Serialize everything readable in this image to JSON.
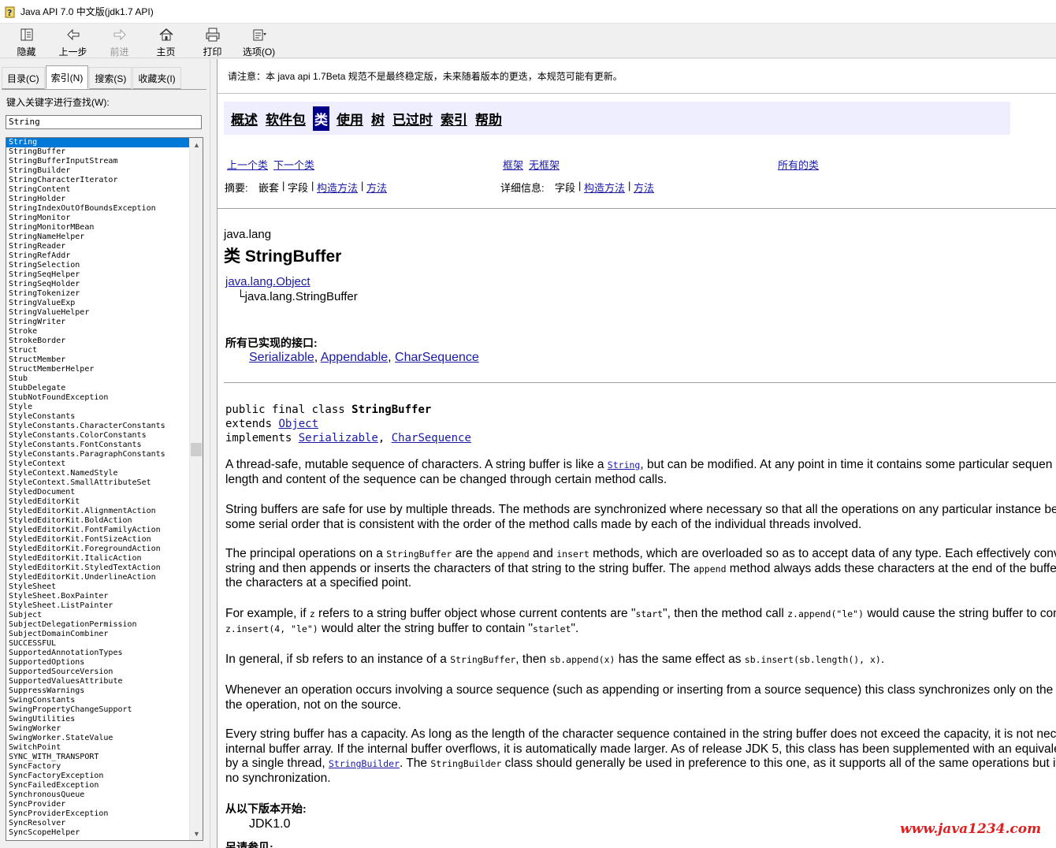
{
  "window": {
    "title": "Java API 7.0 中文版(jdk1.7 API)"
  },
  "toolbar": {
    "buttons": [
      {
        "label": "隐藏",
        "icon": "hide-icon",
        "enabled": true
      },
      {
        "label": "上一步",
        "icon": "back-arrow-icon",
        "enabled": true
      },
      {
        "label": "前进",
        "icon": "forward-arrow-icon",
        "enabled": false
      },
      {
        "label": "主页",
        "icon": "home-icon",
        "enabled": true
      },
      {
        "label": "打印",
        "icon": "printer-icon",
        "enabled": true
      },
      {
        "label": "选项(O)",
        "icon": "options-icon",
        "enabled": true
      }
    ]
  },
  "sidebar": {
    "tabs": [
      "目录(C)",
      "索引(N)",
      "搜索(S)",
      "收藏夹(I)"
    ],
    "active_tab": "索引(N)",
    "keyword_label": "键入关键字进行查找(W):",
    "keyword_value": "String",
    "selected_item": "String",
    "items": [
      "String",
      "StringBuffer",
      "StringBufferInputStream",
      "StringBuilder",
      "StringCharacterIterator",
      "StringContent",
      "StringHolder",
      "StringIndexOutOfBoundsException",
      "StringMonitor",
      "StringMonitorMBean",
      "StringNameHelper",
      "StringReader",
      "StringRefAddr",
      "StringSelection",
      "StringSeqHelper",
      "StringSeqHolder",
      "StringTokenizer",
      "StringValueExp",
      "StringValueHelper",
      "StringWriter",
      "Stroke",
      "StrokeBorder",
      "Struct",
      "StructMember",
      "StructMemberHelper",
      "Stub",
      "StubDelegate",
      "StubNotFoundException",
      "Style",
      "StyleConstants",
      "StyleConstants.CharacterConstants",
      "StyleConstants.ColorConstants",
      "StyleConstants.FontConstants",
      "StyleConstants.ParagraphConstants",
      "StyleContext",
      "StyleContext.NamedStyle",
      "StyleContext.SmallAttributeSet",
      "StyledDocument",
      "StyledEditorKit",
      "StyledEditorKit.AlignmentAction",
      "StyledEditorKit.BoldAction",
      "StyledEditorKit.FontFamilyAction",
      "StyledEditorKit.FontSizeAction",
      "StyledEditorKit.ForegroundAction",
      "StyledEditorKit.ItalicAction",
      "StyledEditorKit.StyledTextAction",
      "StyledEditorKit.UnderlineAction",
      "StyleSheet",
      "StyleSheet.BoxPainter",
      "StyleSheet.ListPainter",
      "Subject",
      "SubjectDelegationPermission",
      "SubjectDomainCombiner",
      "SUCCESSFUL",
      "SupportedAnnotationTypes",
      "SupportedOptions",
      "SupportedSourceVersion",
      "SupportedValuesAttribute",
      "SuppressWarnings",
      "SwingConstants",
      "SwingPropertyChangeSupport",
      "SwingUtilities",
      "SwingWorker",
      "SwingWorker.StateValue",
      "SwitchPoint",
      "SYNC_WITH_TRANSPORT",
      "SyncFactory",
      "SyncFactoryException",
      "SyncFailedException",
      "SynchronousQueue",
      "SyncProvider",
      "SyncProviderException",
      "SyncResolver",
      "SyncScopeHelper"
    ]
  },
  "notice": "请注意：本 java api 1.7Beta 规范不是最终稳定版，未来随着版本的更迭，本规范可能有更新。",
  "navbar": {
    "items": [
      "概述",
      "软件包",
      "类",
      "使用",
      "树",
      "已过时",
      "索引",
      "帮助"
    ],
    "current": "类"
  },
  "subnav": {
    "prev_class": "上一个类",
    "next_class": "下一个类",
    "frames": "框架",
    "no_frames": "无框架",
    "all_classes": "所有的类",
    "summary_label": "摘要:",
    "summary_nested": "嵌套",
    "summary_field": "字段",
    "summary_constructor": "构造方法",
    "summary_method": "方法",
    "detail_label": "详细信息:",
    "detail_field": "字段",
    "detail_constructor": "构造方法",
    "detail_method": "方法",
    "sep": "|"
  },
  "class_info": {
    "package": "java.lang",
    "title": "类 StringBuffer",
    "superclass": "java.lang.Object",
    "this_class": "└java.lang.StringBuffer",
    "interfaces_heading": "所有已实现的接口:",
    "interfaces": [
      "Serializable",
      "Appendable",
      "CharSequence"
    ],
    "decl_line1": "public final class ",
    "decl_name": "StringBuffer",
    "decl_extends": "extends ",
    "decl_object": "Object",
    "decl_implements": "implements ",
    "decl_serializable": "Serializable",
    "decl_comma": ", ",
    "decl_charseq": "CharSequence"
  },
  "description": {
    "p1a": "A thread-safe, mutable sequence of characters. A string buffer is like a ",
    "p1_code": "String",
    "p1b": ", but can be modified. At any point in time it contains some particular sequen",
    "p1c": "length and content of the sequence can be changed through certain method calls.",
    "p2a": "String buffers are safe for use by multiple threads. The methods are synchronized where necessary so that all the operations on any particular instance beh",
    "p2b": "some serial order that is consistent with the order of the method calls made by each of the individual threads involved.",
    "p3a": "The principal operations on a ",
    "p3_code1": "StringBuffer",
    "p3b": " are the ",
    "p3_code2": "append",
    "p3c": " and ",
    "p3_code3": "insert",
    "p3d": " methods, which are overloaded so as to accept data of any type. Each effectively conv",
    "p3e": "string and then appends or inserts the characters of that string to the string buffer. The ",
    "p3_code4": "append",
    "p3f": " method always adds these characters at the end of the buffer",
    "p3g": "the characters at a specified point.",
    "p4a": "For example, if ",
    "p4_code1": "z",
    "p4b": " refers to a string buffer object whose current contents are \"",
    "p4_code2": "start",
    "p4c": "\", then the method call ",
    "p4_code3": "z.append(\"le\")",
    "p4d": " would cause the string buffer to cont",
    "p4_code4": "z.insert(4, \"le\")",
    "p4e": " would alter the string buffer to contain \"",
    "p4_code5": "starlet",
    "p4f": "\".",
    "p5a": "In general, if sb refers to an instance of a ",
    "p5_code1": "StringBuffer",
    "p5b": ", then ",
    "p5_code2": "sb.append(x)",
    "p5c": " has the same effect as ",
    "p5_code3": "sb.insert(sb.length(), x)",
    "p5d": ".",
    "p6a": "Whenever an operation occurs involving a source sequence (such as appending or inserting from a source sequence) this class synchronizes only on the s",
    "p6b": "the operation, not on the source.",
    "p7a": "Every string buffer has a capacity. As long as the length of the character sequence contained in the string buffer does not exceed the capacity, it is not nece",
    "p7b": "internal buffer array. If the internal buffer overflows, it is automatically made larger. As of release JDK 5, this class has been supplemented with an equivale",
    "p7c": "by a single thread, ",
    "p7_code1": "StringBuilder",
    "p7d": ". The ",
    "p7_code2": "StringBuilder",
    "p7e": " class should generally be used in preference to this one, as it supports all of the same operations but it",
    "p7f": "no synchronization."
  },
  "since": {
    "heading": "从以下版本开始:",
    "value": "JDK1.0"
  },
  "see_also": {
    "heading": "另请参见:"
  },
  "watermark": "www.java1234.com",
  "colors": {
    "nav_bg": "#eeeeff",
    "nav_current": "#00008b",
    "link": "#1a1aa6",
    "selection": "#0078d7",
    "watermark": "#e02020"
  }
}
